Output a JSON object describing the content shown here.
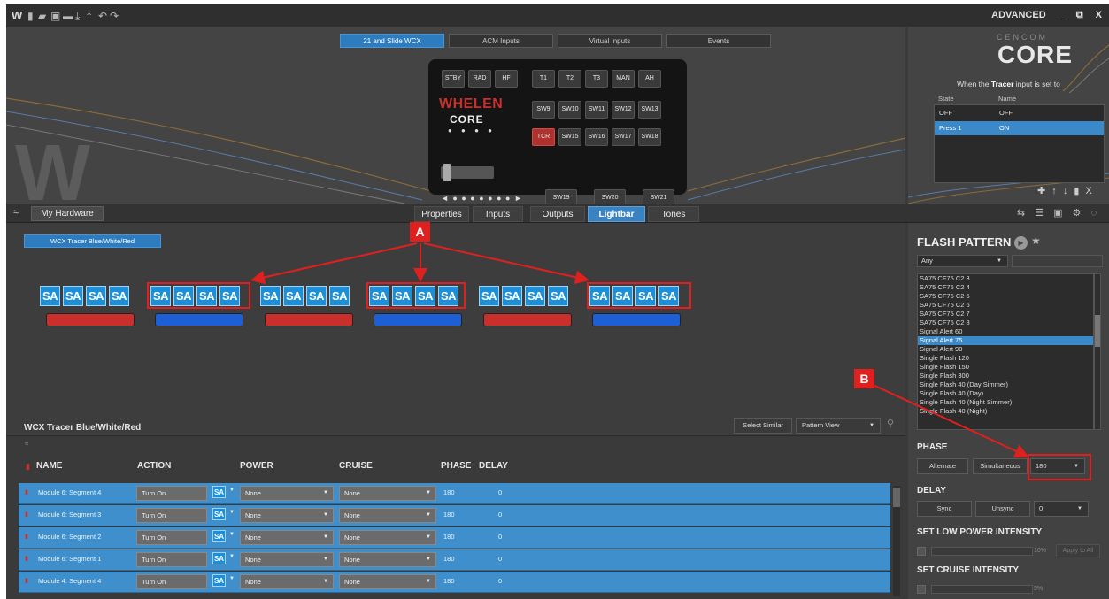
{
  "window": {
    "logo": "W",
    "mode": "ADVANCED",
    "minimize": "_",
    "restore": "⧉",
    "close": "X"
  },
  "top_tabs": [
    "21 and Slide WCX",
    "ACM Inputs",
    "Virtual Inputs",
    "Events"
  ],
  "control_head": {
    "row1": [
      "STBY",
      "RAD",
      "HF",
      "T1",
      "T2",
      "T3",
      "MAN",
      "AH"
    ],
    "row2": [
      "SW9",
      "SW10",
      "SW11",
      "SW12",
      "SW13"
    ],
    "row3": [
      "TCR",
      "SW15",
      "SW16",
      "SW17",
      "SW18"
    ],
    "row4": [
      "SW19",
      "SW20",
      "SW21"
    ],
    "brand": "WHELEN",
    "brand_sub": "CORE",
    "dots": "● ● ● ●",
    "arrow_dots": "◄ ● ● ● ● ● ● ● ►"
  },
  "cencom": {
    "brand_small": "CENCOM",
    "brand_large": "CORE",
    "tracer_pre": "When the",
    "tracer_name": "Tracer",
    "tracer_post": "input is set to",
    "col_state": "State",
    "col_name": "Name",
    "rows": [
      {
        "state": "OFF",
        "name": "OFF"
      },
      {
        "state": "Press 1",
        "name": "ON"
      }
    ],
    "tools": "✚ ↑ ↓ ▮ X"
  },
  "toolbar": {
    "collapse": "≈",
    "my_hardware": "My Hardware",
    "tabs": [
      "Properties",
      "Inputs",
      "Outputs",
      "Lightbar",
      "Tones"
    ],
    "icons": "⇆ ☰ ▣ ⚙ ◌"
  },
  "lightbar": {
    "config_button": "WCX Tracer Blue/White/Red",
    "title": "WCX Tracer Blue/White/Red",
    "sa_label": "SA",
    "select_similar": "Select Similar",
    "pattern_view": "Pattern View",
    "annotation_A": "A",
    "annotation_B": "B",
    "bar_colors": [
      "#c9302c",
      "#1f5fd6",
      "#c9302c",
      "#1f5fd6",
      "#c9302c",
      "#1f5fd6"
    ]
  },
  "table": {
    "collapse": "≈",
    "headers": [
      "NAME",
      "ACTION",
      "POWER",
      "CRUISE",
      "PHASE",
      "DELAY"
    ],
    "rows": [
      {
        "name": "Module 6: Segment 4",
        "action": "Turn On",
        "power": "None",
        "cruise": "None",
        "phase": "180",
        "delay": "0"
      },
      {
        "name": "Module 6: Segment 3",
        "action": "Turn On",
        "power": "None",
        "cruise": "None",
        "phase": "180",
        "delay": "0"
      },
      {
        "name": "Module 6: Segment 2",
        "action": "Turn On",
        "power": "None",
        "cruise": "None",
        "phase": "180",
        "delay": "0"
      },
      {
        "name": "Module 6: Segment 1",
        "action": "Turn On",
        "power": "None",
        "cruise": "None",
        "phase": "180",
        "delay": "0"
      },
      {
        "name": "Module 4: Segment 4",
        "action": "Turn On",
        "power": "None",
        "cruise": "None",
        "phase": "180",
        "delay": "0"
      }
    ]
  },
  "flash_pattern": {
    "title": "FLASH PATTERN",
    "filter": "Any",
    "items": [
      "SA75 CF75 C2 3",
      "SA75 CF75 C2 4",
      "SA75 CF75 C2 5",
      "SA75 CF75 C2 6",
      "SA75 CF75 C2 7",
      "SA75 CF75 C2 8",
      "Signal Alert 60",
      "Signal Alert 75",
      "Signal Alert 90",
      "Single Flash 120",
      "Single Flash 150",
      "Single Flash 300",
      "Single Flash 40 (Day Simmer)",
      "Single Flash 40 (Day)",
      "Single Flash 40 (Night Simmer)",
      "Single Flash 40 (Night)"
    ],
    "selected": "Signal Alert 75",
    "phase_title": "PHASE",
    "alternate": "Alternate",
    "simultaneous": "Simultaneous",
    "phase_value": "180",
    "delay_title": "DELAY",
    "sync": "Sync",
    "unsync": "Unsync",
    "delay_value": "0",
    "low_power_title": "SET LOW POWER INTENSITY",
    "low_power_value": "10%",
    "apply_all": "Apply to All",
    "cruise_title": "SET CRUISE INTENSITY",
    "cruise_value": "5%"
  }
}
